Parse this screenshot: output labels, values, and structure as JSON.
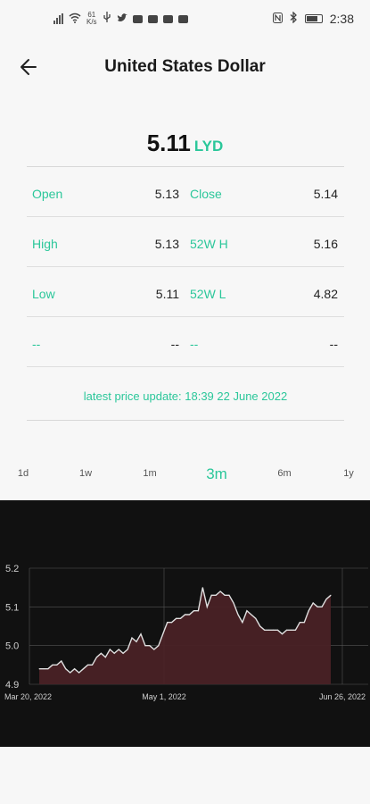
{
  "status_bar": {
    "speed": "61\nK/s",
    "time": "2:38"
  },
  "header": {
    "title": "United States Dollar"
  },
  "price": {
    "value": "5.11",
    "currency": "LYD"
  },
  "stats": [
    {
      "l1": "Open",
      "v1": "5.13",
      "l2": "Close",
      "v2": "5.14"
    },
    {
      "l1": "High",
      "v1": "5.13",
      "l2": "52W H",
      "v2": "5.16"
    },
    {
      "l1": "Low",
      "v1": "5.11",
      "l2": "52W L",
      "v2": "4.82"
    },
    {
      "l1": "--",
      "v1": "--",
      "l2": "--",
      "v2": "--"
    }
  ],
  "update_text": "latest price update: 18:39 22 June 2022",
  "ranges": [
    {
      "label": "1d",
      "active": false
    },
    {
      "label": "1w",
      "active": false
    },
    {
      "label": "1m",
      "active": false
    },
    {
      "label": "3m",
      "active": true
    },
    {
      "label": "6m",
      "active": false
    },
    {
      "label": "1y",
      "active": false
    }
  ],
  "colors": {
    "accent": "#2bc79a",
    "chart_bg": "#111111",
    "area_fill": "#4a2226",
    "line": "#e0e0e0"
  },
  "chart_data": {
    "type": "area",
    "y_ticks": [
      "5.2",
      "5.1",
      "5.0",
      "4.9"
    ],
    "ylim": [
      4.9,
      5.2
    ],
    "x_ticks": [
      "Mar 20, 2022",
      "May 1, 2022",
      "Jun 26, 2022"
    ],
    "grid": true,
    "series": [
      {
        "values": [
          4.94,
          4.94,
          4.94,
          4.95,
          4.95,
          4.96,
          4.94,
          4.93,
          4.94,
          4.93,
          4.94,
          4.95,
          4.95,
          4.97,
          4.98,
          4.97,
          4.99,
          4.98,
          4.99,
          4.98,
          4.99,
          5.02,
          5.01,
          5.03,
          5.0,
          5.0,
          4.99,
          5.0,
          5.03,
          5.06,
          5.06,
          5.07,
          5.07,
          5.08,
          5.08,
          5.09,
          5.09,
          5.15,
          5.1,
          5.13,
          5.13,
          5.14,
          5.13,
          5.13,
          5.11,
          5.08,
          5.06,
          5.09,
          5.08,
          5.07,
          5.05,
          5.04,
          5.04,
          5.04,
          5.04,
          5.03,
          5.04,
          5.04,
          5.04,
          5.06,
          5.06,
          5.09,
          5.11,
          5.1,
          5.1,
          5.12,
          5.13
        ]
      }
    ]
  }
}
